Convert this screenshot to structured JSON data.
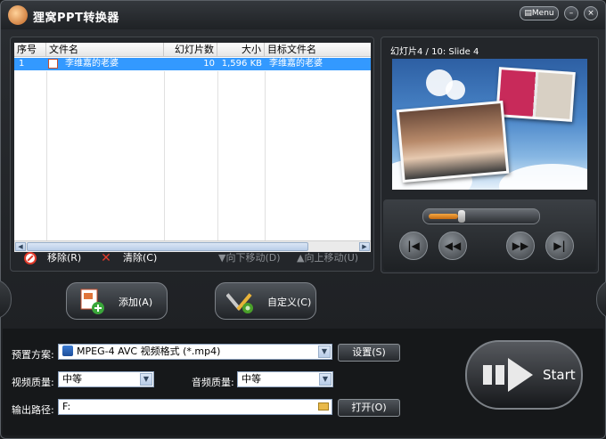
{
  "window": {
    "title": "狸窝PPT转换器",
    "menu_label": "Menu",
    "minimize_label": "–",
    "close_label": "×"
  },
  "file_list": {
    "columns": [
      "序号",
      "文件名",
      "幻灯片数",
      "大小",
      "目标文件名"
    ],
    "rows": [
      {
        "index": "1",
        "filename": "李维嘉的老婆",
        "slides": "10",
        "size": "1,596 KB",
        "target": "李维嘉的老婆",
        "selected": true
      }
    ]
  },
  "list_toolbar": {
    "remove_label": "移除(R)",
    "clear_label": "清除(C)",
    "move_down_label": "向下移动(D)",
    "move_up_label": "向上移动(U)"
  },
  "preview": {
    "slide_label": "幻灯片4 / 10: Slide 4",
    "progress_fraction": 0.3
  },
  "actions": {
    "add_label": "添加(A)",
    "customize_label": "自定义(C)"
  },
  "settings": {
    "preset_label": "预置方案:",
    "preset_value": "MPEG-4 AVC 视频格式 (*.mp4)",
    "settings_button": "设置(S)",
    "video_quality_label": "视频质量:",
    "video_quality_value": "中等",
    "audio_quality_label": "音频质量:",
    "audio_quality_value": "中等",
    "output_path_label": "输出路径:",
    "output_path_value": "F:",
    "open_button": "打开(O)",
    "start_label": "Start"
  },
  "colors": {
    "selection": "#3399ff",
    "accent_orange": "#f3a743",
    "remove_red": "#e23a2a"
  }
}
